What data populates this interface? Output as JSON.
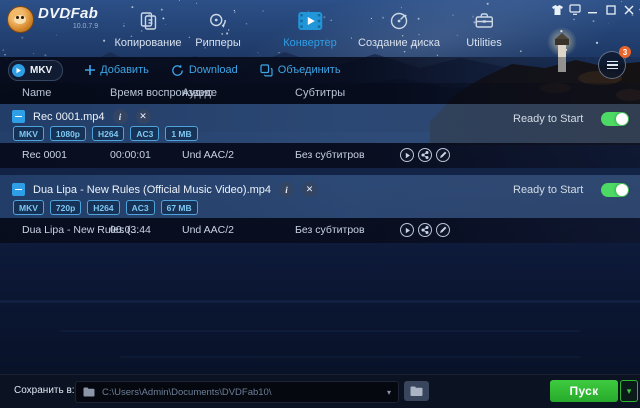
{
  "app": {
    "title": "DVDFab",
    "version": "10.0.7.9"
  },
  "window_controls": {
    "icons": [
      "shirt",
      "monitor",
      "minimize",
      "maximize",
      "close"
    ]
  },
  "nav": {
    "tabs": [
      {
        "label": "Копирование",
        "icon": "copy-icon",
        "active": false
      },
      {
        "label": "Рипперы",
        "icon": "ripper-icon",
        "active": false
      },
      {
        "label": "Конвертер",
        "icon": "converter-icon",
        "active": true
      },
      {
        "label": "Создание диска",
        "icon": "disc-burn-icon",
        "active": false
      },
      {
        "label": "Utilities",
        "icon": "toolbox-icon",
        "active": false
      }
    ]
  },
  "toolbar": {
    "profile": "MKV",
    "add": "Добавить",
    "download": "Download",
    "merge": "Объединить",
    "queue_count": "3"
  },
  "table": {
    "columns": [
      "Name",
      "Время воспроизведе",
      "Аудио",
      "Субтитры"
    ]
  },
  "items": [
    {
      "filename": "Rec 0001.mp4",
      "badges": [
        "MKV",
        "1080p",
        "H264",
        "AC3",
        "1 MB"
      ],
      "status": "Ready to Start",
      "toggle_on": true,
      "track": {
        "name": "Rec 0001",
        "duration": "00:00:01",
        "audio": "Und AAC/2",
        "subtitle": "Без субтитров"
      }
    },
    {
      "filename": "Dua Lipa - New Rules (Official Music Video).mp4",
      "badges": [
        "MKV",
        "720p",
        "H264",
        "AC3",
        "67 MB"
      ],
      "status": "Ready to Start",
      "toggle_on": true,
      "track": {
        "name": "Dua Lipa - New Rules (...",
        "duration": "00:03:44",
        "audio": "Und AAC/2",
        "subtitle": "Без субтитров"
      }
    }
  ],
  "footer": {
    "save_label": "Сохранить в:",
    "path": "C:\\Users\\Admin\\Documents\\DVDFab10\\",
    "start": "Пуск"
  },
  "colors": {
    "accent": "#2e9fe6",
    "toggle_on": "#4cd964",
    "start_button": "#2eb630",
    "queue_badge": "#e8662c",
    "badge_text": "#7ec8f2"
  }
}
